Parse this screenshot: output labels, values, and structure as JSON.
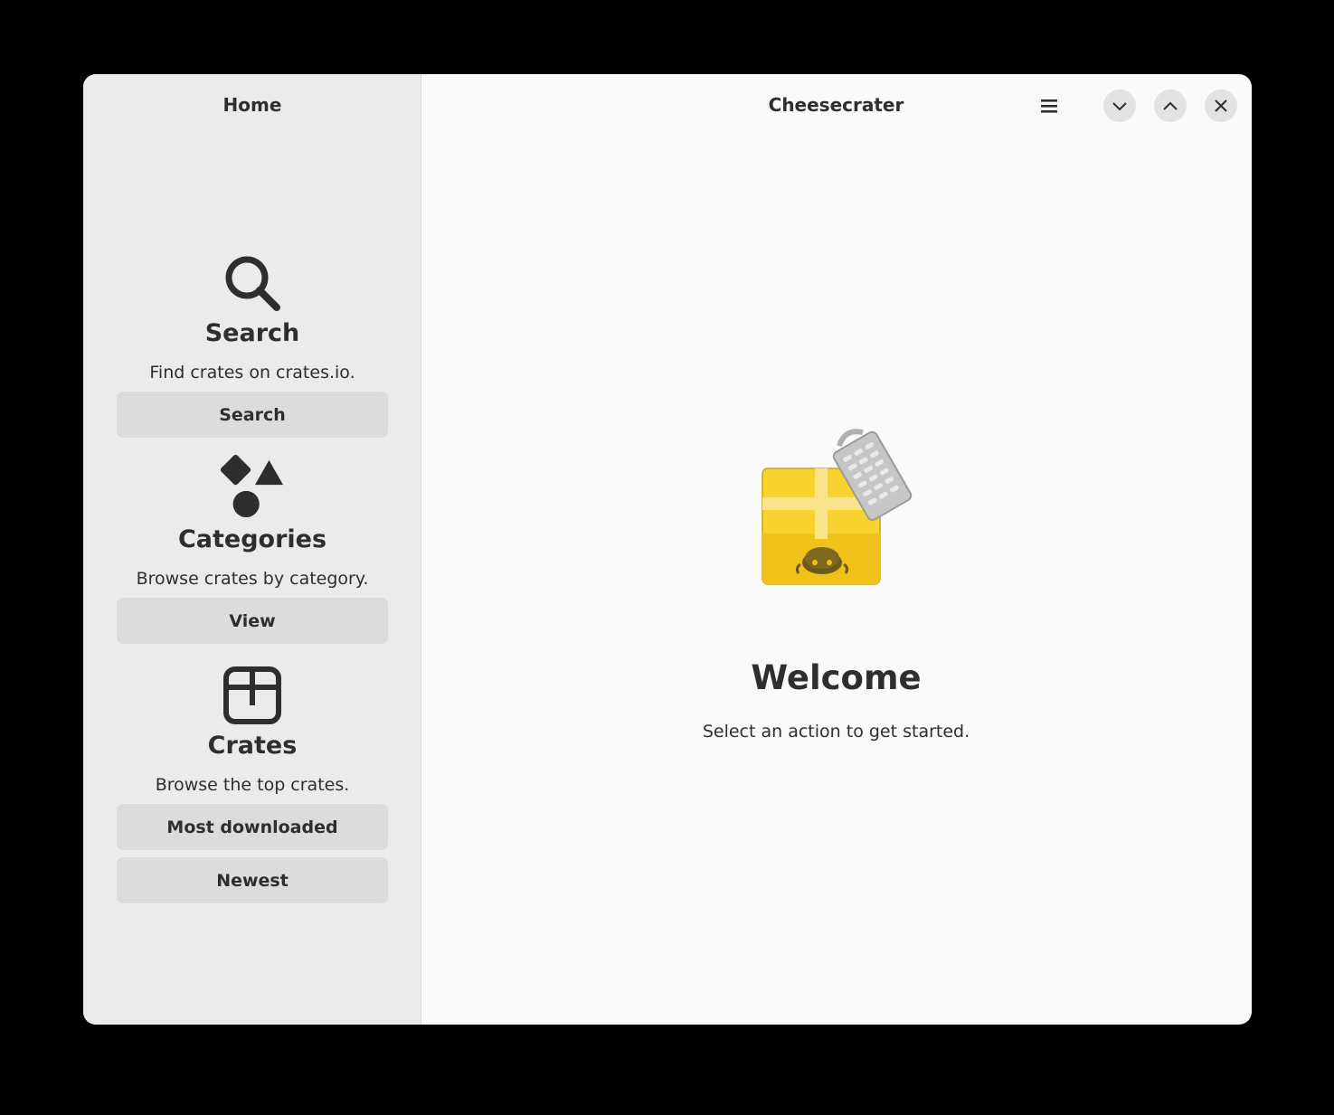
{
  "sidebar": {
    "title": "Home",
    "sections": [
      {
        "icon": "search-icon",
        "heading": "Search",
        "description": "Find crates on crates.io.",
        "buttons": [
          "Search"
        ]
      },
      {
        "icon": "shapes-icon",
        "heading": "Categories",
        "description": "Browse crates by category.",
        "buttons": [
          "View"
        ]
      },
      {
        "icon": "crate-icon",
        "heading": "Crates",
        "description": "Browse the top crates.",
        "buttons": [
          "Most downloaded",
          "Newest"
        ]
      }
    ]
  },
  "main": {
    "title": "Cheesecrater",
    "welcome_title": "Welcome",
    "welcome_desc": "Select an action to get started."
  },
  "colors": {
    "sidebar_bg": "#ebebeb",
    "main_bg": "#fafafa",
    "button_bg": "#dcdcdc",
    "text": "#2e2e2e",
    "crate_yellow": "#f6d32d"
  }
}
